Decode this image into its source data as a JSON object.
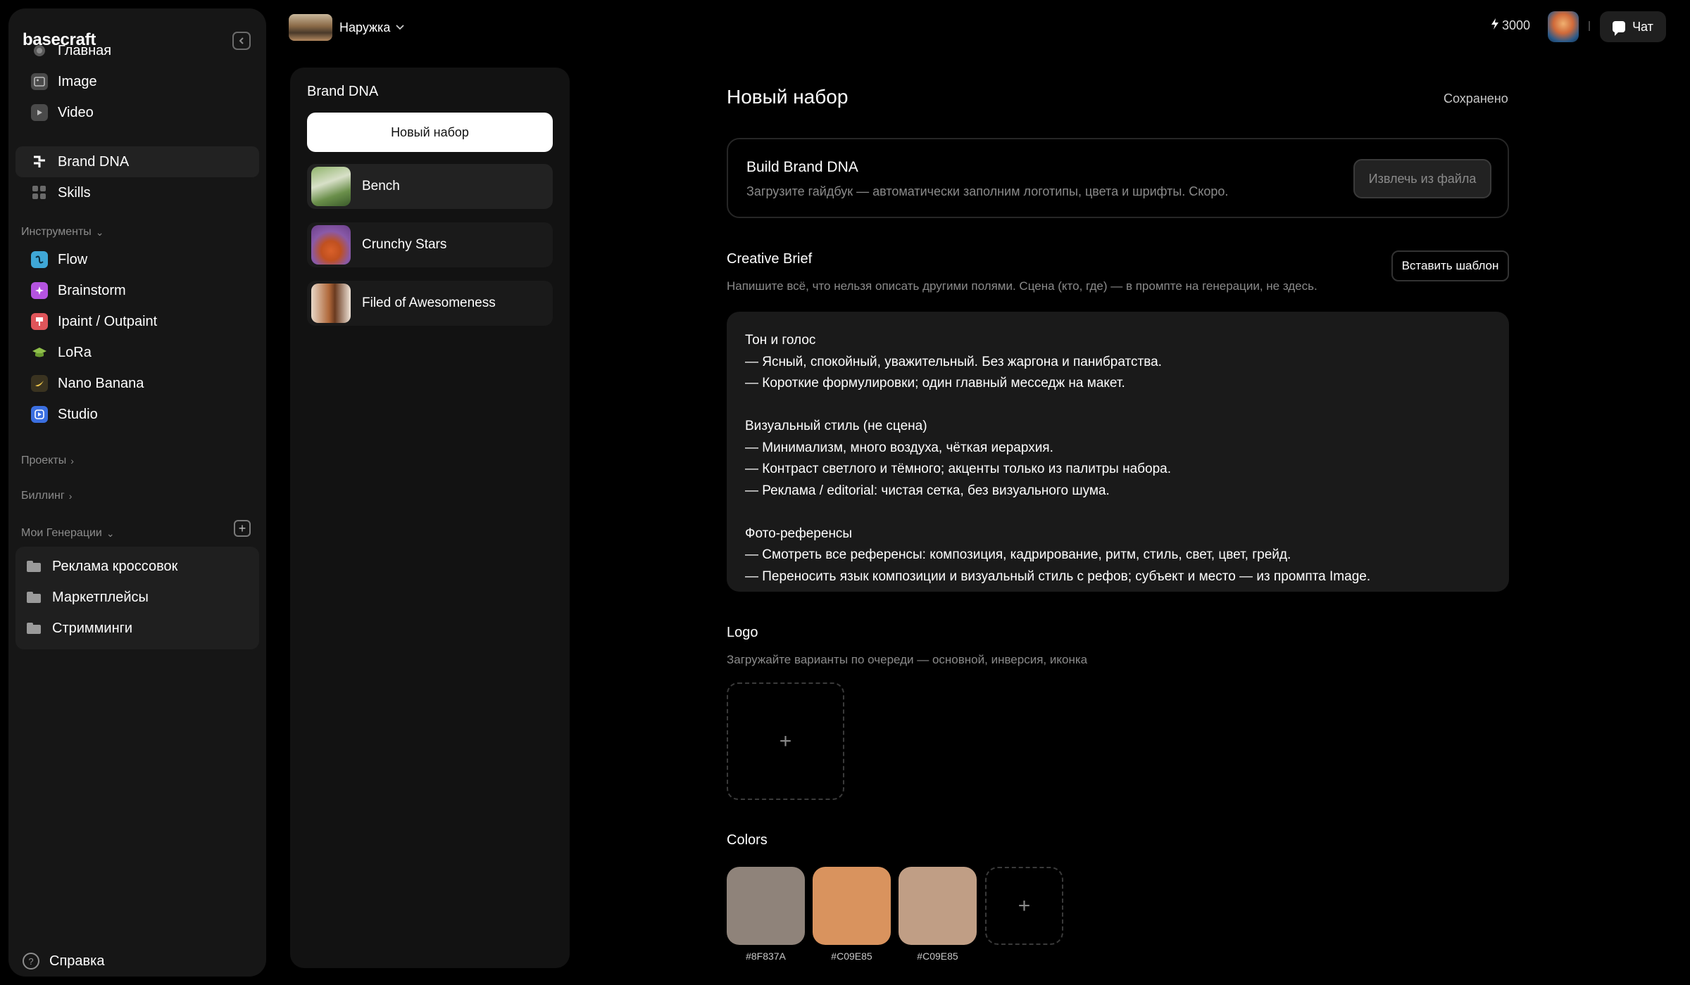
{
  "app": {
    "name": "basecraft"
  },
  "sidebar": {
    "nav": [
      {
        "label": "Главная",
        "icon": "home-icon"
      },
      {
        "label": "Image",
        "icon": "image-icon"
      },
      {
        "label": "Video",
        "icon": "video-icon"
      },
      {
        "label": "Brand DNA",
        "icon": "brand-dna-icon",
        "active": true
      },
      {
        "label": "Skills",
        "icon": "skills-grid-icon"
      }
    ],
    "tools_label": "Инструменты",
    "tools": [
      {
        "label": "Flow",
        "icon": "flow-icon",
        "color": "#3fa7d6"
      },
      {
        "label": "Brainstorm",
        "icon": "brainstorm-icon",
        "color": "#b553e0"
      },
      {
        "label": "Ipaint / Outpaint",
        "icon": "brush-icon",
        "color": "#e0555a"
      },
      {
        "label": "LoRa",
        "icon": "graduation-cap-icon",
        "color": "#5e8c3a"
      },
      {
        "label": "Nano Banana",
        "icon": "banana-icon",
        "color": "#6b5a2a"
      },
      {
        "label": "Studio",
        "icon": "studio-play-icon",
        "color": "#3b6fe0"
      }
    ],
    "projects_label": "Проекты",
    "billing_label": "Биллинг",
    "generations_label": "Мои Генерации",
    "generations": [
      {
        "label": "Реклама кроссовок"
      },
      {
        "label": "Маркетплейсы"
      },
      {
        "label": "Стримминги"
      }
    ],
    "help_label": "Справка"
  },
  "topbar": {
    "project_name": "Наружка",
    "credits": "3000",
    "chat_label": "Чат"
  },
  "brand_panel": {
    "title": "Brand DNA",
    "new_button": "Новый набор",
    "items": [
      {
        "name": "Bench"
      },
      {
        "name": "Crunchy Stars"
      },
      {
        "name": "Filed of Awesomeness"
      }
    ]
  },
  "main": {
    "title": "Новый набор",
    "saved_status": "Сохранено",
    "build": {
      "title": "Build Brand DNA",
      "description": "Загрузите гайдбук — автоматически заполним логотипы, цвета и шрифты. Скоро.",
      "extract_button": "Извлечь из файла"
    },
    "brief": {
      "title": "Creative Brief",
      "description": "Напишите всё, что нельзя описать другими полями. Сцена (кто, где) — в промпте на генерации, не здесь.",
      "insert_button": "Вставить шаблон",
      "lines": [
        "Тон и голос",
        "— Ясный, спокойный, уважительный. Без жаргона и панибратства.",
        "— Короткие формулировки; один главный месседж на макет.",
        "",
        "Визуальный стиль (не сцена)",
        "— Минимализм, много воздуха, чёткая иерархия.",
        "— Контраст светлого и тёмного; акценты только из палитры набора.",
        "— Реклама / editorial: чистая сетка, без визуального шума.",
        "",
        "Фото-референсы",
        "— Смотреть все референсы: композиция, кадрирование, ритм, стиль, свет, цвет, грейд.",
        "— Переносить язык композиции и визуальный стиль с рефов; субъект и место — из промпта Image."
      ]
    },
    "logo": {
      "title": "Logo",
      "description": "Загружайте варианты по очереди — основной, инверсия, иконка"
    },
    "colors": {
      "title": "Colors",
      "swatches": [
        {
          "label": "#8F837A",
          "color": "#8F837A"
        },
        {
          "label": "#C09E85",
          "color": "#D9935E"
        },
        {
          "label": "#C09E85",
          "color": "#C09E85"
        }
      ]
    }
  }
}
